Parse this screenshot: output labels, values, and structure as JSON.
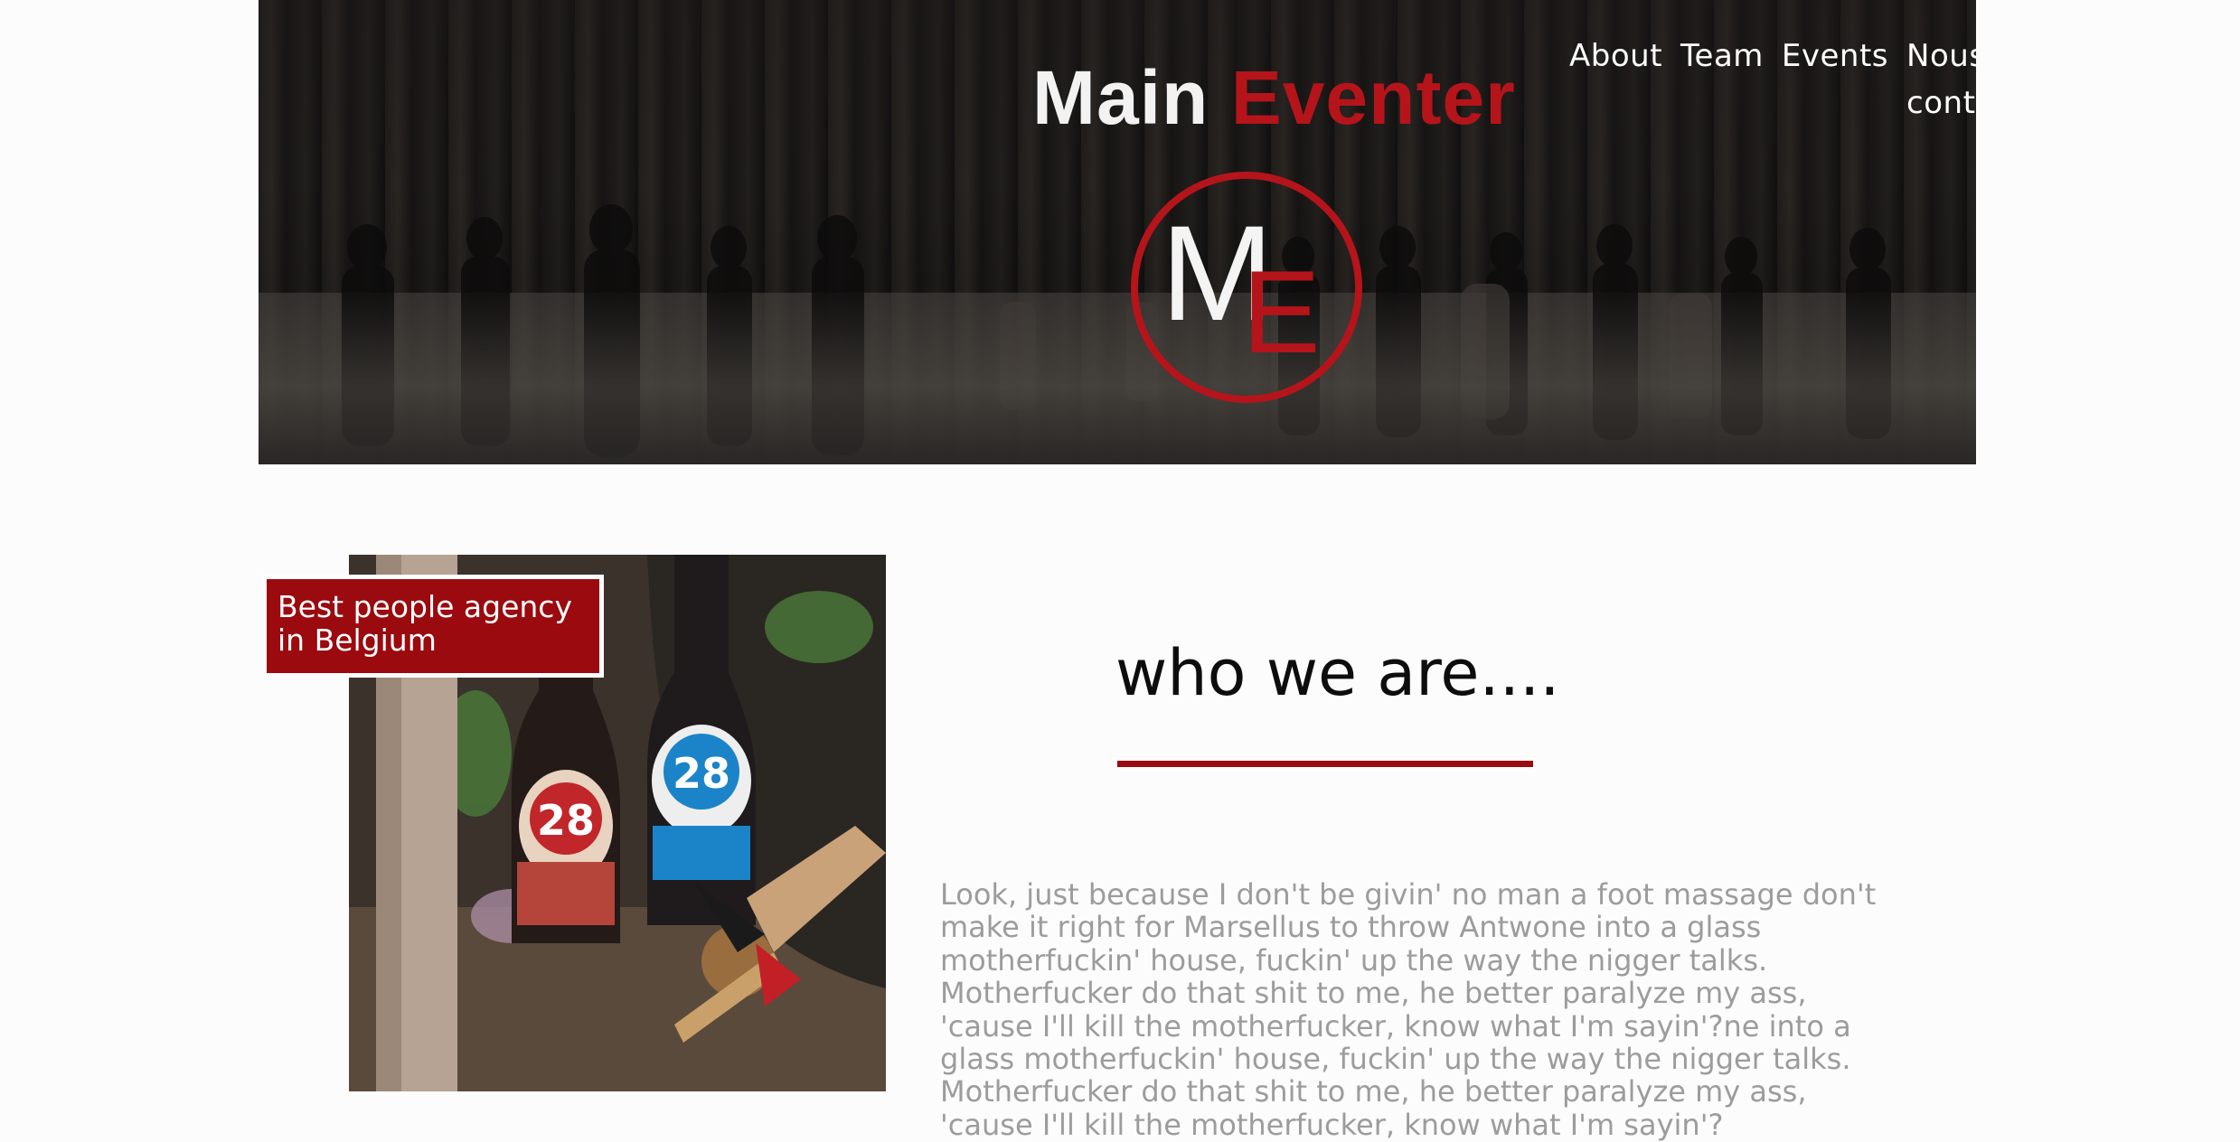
{
  "header": {
    "brand_word_1": "Main",
    "brand_word_2": "Eventer",
    "emblem_letter_1": "M",
    "emblem_letter_2": "E",
    "accent_color": "#b5141b"
  },
  "nav": {
    "items": [
      {
        "label": "About"
      },
      {
        "label": "Team"
      },
      {
        "label": "Events"
      },
      {
        "label": "Nous contacter"
      }
    ]
  },
  "intro": {
    "badge_text": "Best people agency in Belgium",
    "heading": "who we are....",
    "body": "Look, just because I don't be givin' no man a foot massage don't make it right for Marsellus to throw Antwone into a glass motherfuckin' house, fuckin' up the way the nigger talks. Motherfucker do that shit to me, he better paralyze my ass, 'cause I'll kill the motherfucker, know what I'm sayin'?ne into a glass motherfuckin' house, fuckin' up the way the nigger talks. Motherfucker do that shit to me, he better paralyze my ass, 'cause I'll kill the motherfucker, know what I'm sayin'?",
    "photo_label_1": "28",
    "photo_label_2": "28",
    "brand_red": "#9a0a0f"
  }
}
